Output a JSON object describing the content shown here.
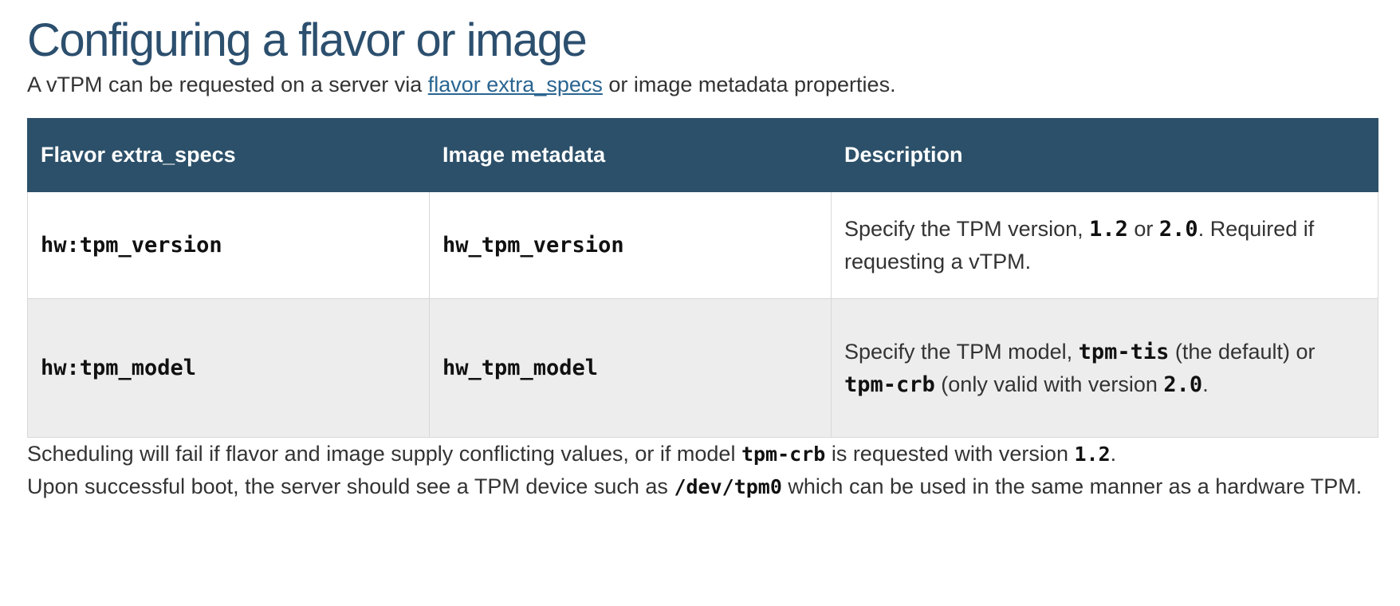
{
  "title": "Configuring a flavor or image",
  "intro": {
    "before": "A vTPM can be requested on a server via ",
    "link": "flavor extra_specs",
    "after": " or image metadata properties."
  },
  "table": {
    "headers": [
      "Flavor extra_specs",
      "Image metadata",
      "Description"
    ],
    "rows": [
      {
        "flavor": "hw:tpm_version",
        "image": "hw_tpm_version",
        "desc": {
          "t1": "Specify the TPM version, ",
          "c1": "1.2",
          "t2": " or ",
          "c2": "2.0",
          "t3": ". Required if requesting a vTPM."
        }
      },
      {
        "flavor": "hw:tpm_model",
        "image": "hw_tpm_model",
        "desc": {
          "t1": "Specify the TPM model, ",
          "c1": "tpm-tis",
          "t2": " (the default) or ",
          "c2": "tpm-crb",
          "t3": " (only valid with version ",
          "c3": "2.0",
          "t4": "."
        }
      }
    ]
  },
  "para2": {
    "t1": "Scheduling will fail if flavor and image supply conflicting values, or if model ",
    "c1": "tpm-crb",
    "t2": " is requested with version ",
    "c2": "1.2",
    "t3": "."
  },
  "para3": {
    "t1": "Upon successful boot, the server should see a TPM device such as ",
    "c1": "/dev/tpm0",
    "t2": " which can be used in the same manner as a hardware TPM."
  }
}
